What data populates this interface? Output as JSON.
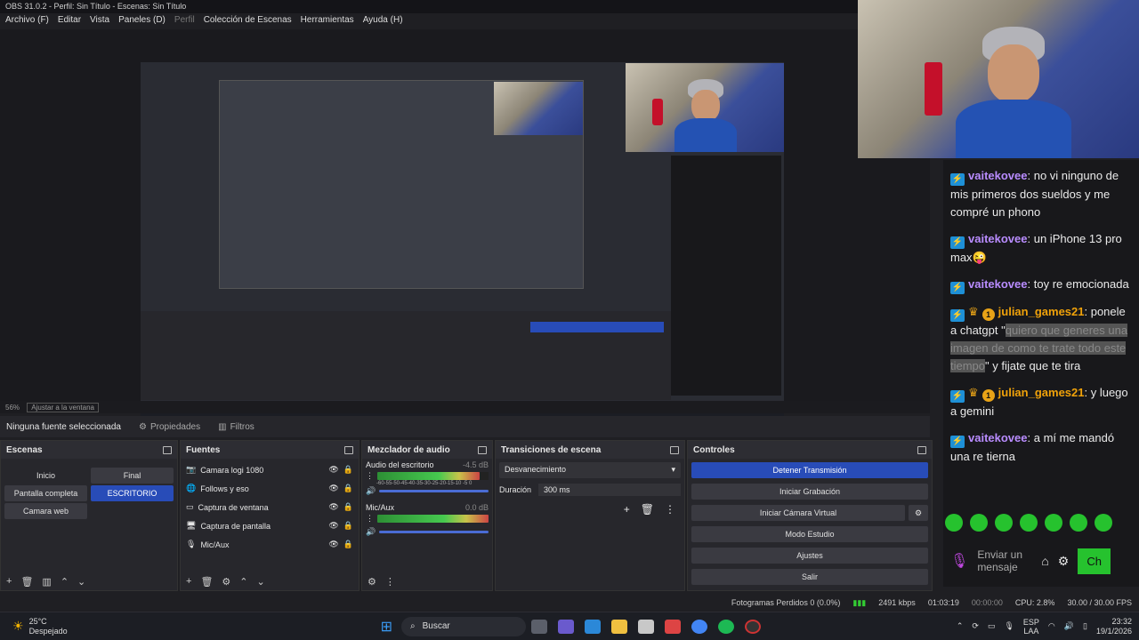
{
  "window": {
    "title": "OBS 31.0.2 - Perfil: Sin Título - Escenas: Sin Título"
  },
  "menu": [
    "Archivo (F)",
    "Editar",
    "Vista",
    "Paneles (D)",
    "Perfil",
    "Colección de Escenas",
    "Herramientas",
    "Ayuda (H)"
  ],
  "preview": {
    "zoom": "56%",
    "scale_mode": "Ajustar a la ventana"
  },
  "source_bar": {
    "no_source": "Ninguna fuente seleccionada",
    "properties": "Propiedades",
    "filters": "Filtros"
  },
  "scenes": {
    "title": "Escenas",
    "items": [
      "Inicio",
      "Final",
      "Pantalla completa",
      "ESCRITORIO",
      "Camara web"
    ],
    "selected": "ESCRITORIO"
  },
  "sources": {
    "title": "Fuentes",
    "items": [
      "Camara logi 1080",
      "Follows y eso",
      "Captura de ventana",
      "Captura de pantalla",
      "Mic/Aux"
    ]
  },
  "mixer": {
    "title": "Mezclador de audio",
    "tracks": [
      {
        "name": "Audio del escritorio",
        "db": "-4.5 dB",
        "level": 0.92
      },
      {
        "name": "Mic/Aux",
        "db": "0.0 dB",
        "level": 1.0
      }
    ],
    "scale": "-60-55-50-45-40-35-30-25-20-15-10 -5 0"
  },
  "transitions": {
    "title": "Transiciones de escena",
    "type": "Desvanecimiento",
    "duration_label": "Duración",
    "duration": "300 ms"
  },
  "controls": {
    "title": "Controles",
    "buttons": [
      "Detener Transmisión",
      "Iniciar Grabación",
      "Iniciar Cámara Virtual",
      "Modo Estudio",
      "Ajustes",
      "Salir"
    ]
  },
  "status": {
    "dropped": "Fotogramas Perdidos 0 (0.0%)",
    "bitrate": "2491 kbps",
    "stream_time": "01:03:19",
    "rec_time": "00:00:00",
    "cpu": "CPU: 2.8%",
    "fps": "30.00 / 30.00 FPS"
  },
  "taskbar": {
    "temp": "25°C",
    "weather": "Despejado",
    "search": "Buscar",
    "lang1": "ESP",
    "lang2": "LAA",
    "time": "23:32",
    "date": "19/1/2026"
  },
  "chat": {
    "messages": [
      {
        "user": "vaitekovee",
        "color": "#b98cff",
        "text": "no vi ninguno de mis primeros dos sueldos y me compré un phono"
      },
      {
        "user": "vaitekovee",
        "color": "#b98cff",
        "text": "un iPhone 13 pro max😜"
      },
      {
        "user": "vaitekovee",
        "color": "#b98cff",
        "text": "toy re emocionada"
      },
      {
        "user": "julian_games21",
        "color": "#f0a20a",
        "text_pre": "ponele a chatgpt \"",
        "censored": "quiero que generes una imagen de como te trate todo este tiempo",
        "text_post": "\" y fijate que te tira"
      },
      {
        "user": "julian_games21",
        "color": "#f0a20a",
        "text": "y luego a gemini"
      },
      {
        "user": "vaitekovee",
        "color": "#b98cff",
        "text": "a mí me mandó una re tierna"
      }
    ],
    "input_placeholder": "Enviar un mensaje",
    "chat_button": "Ch"
  }
}
